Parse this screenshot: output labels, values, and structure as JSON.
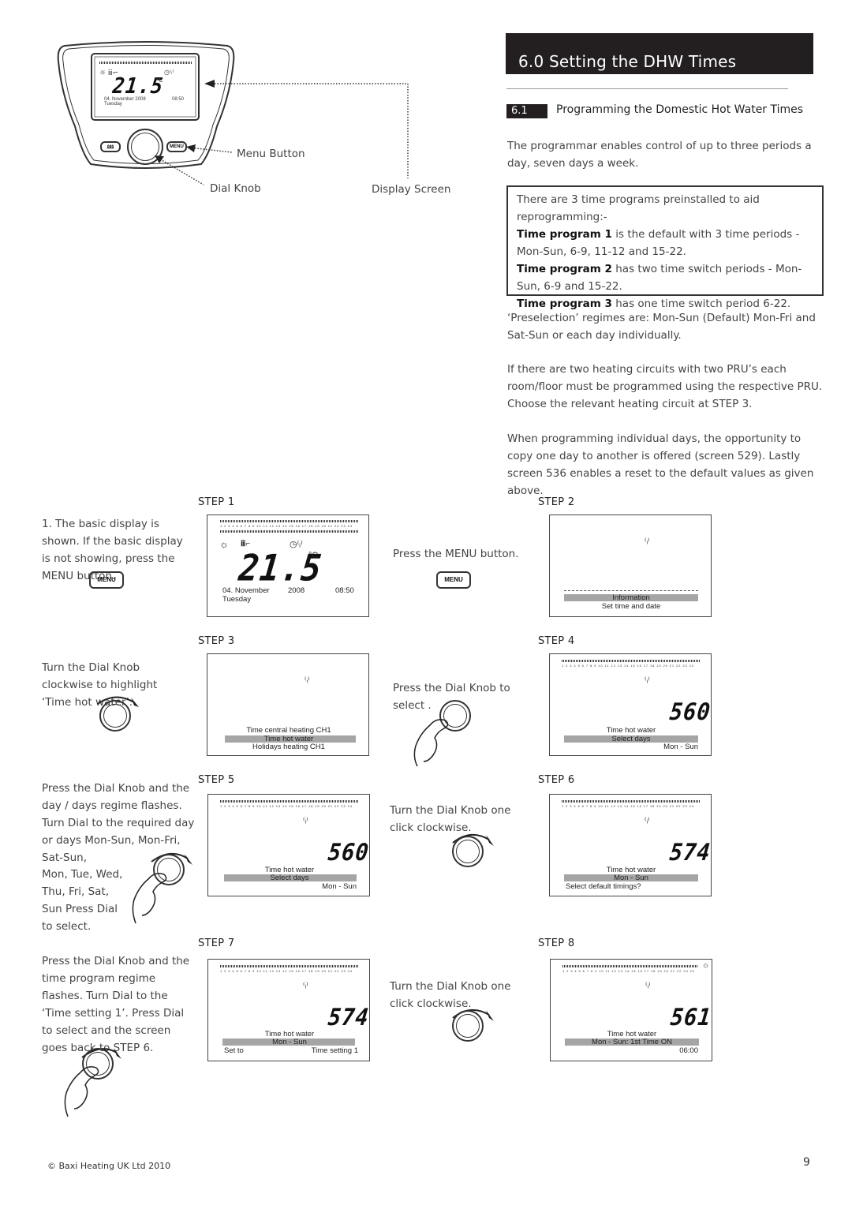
{
  "header": {
    "title": "6.0   Setting the DHW Times",
    "section_number": "6.1",
    "section_title": "Programming the Domestic Hot Water Times"
  },
  "intro": "The programmar enables control of up to three periods a day, seven days a week.",
  "programs_box": {
    "intro": "There are 3 time programs preinstalled to aid reprogramming:-",
    "items": [
      {
        "label": "Time program 1",
        "text": " is the default with 3 time periods - Mon-Sun, 6-9, 11-12 and 15-22."
      },
      {
        "label": "Time program 2",
        "text": " has two time switch periods - Mon-Sun, 6-9 and 15-22."
      },
      {
        "label": "Time program 3",
        "text": " has one time switch period 6-22."
      }
    ]
  },
  "paragraphs": [
    "‘Preselection’ regimes are: Mon-Sun (Default) Mon-Fri and Sat-Sun or each day individually.",
    "If there are two heating circuits with two PRU’s each room/floor must be programmed using the respective PRU. Choose the relevant heating circuit at STEP 3.",
    "When programming individual days, the opportunity to copy one day to another is offered (screen 529). Lastly screen 536 enables a reset to the default values as given above."
  ],
  "device_diagram": {
    "labels": {
      "menu_button": "Menu Button",
      "dial_knob": "Dial Knob",
      "display_screen": "Display Screen"
    },
    "screen": {
      "temp": "21.5",
      "unit": "°C",
      "date": "04.  November   2008",
      "time": "08:50",
      "day": "Tuesday"
    },
    "menu_label": "MENU"
  },
  "steps": [
    {
      "label": "STEP 1",
      "instruction": "1. The basic display is shown. If the basic display is not showing, press the MENU button.",
      "screen": {
        "temp": "21.5",
        "unit": "°C",
        "date": "04.  November",
        "year": "2008",
        "time": "08:50",
        "day": "Tuesday"
      }
    },
    {
      "label": "STEP 2",
      "instruction": "Press the MENU button.",
      "screen": {
        "highlight": "Information",
        "line2": "Set time and date"
      }
    },
    {
      "label": "STEP 3",
      "instruction": "Turn the Dial Knob clockwise to highlight ‘Time hot water’.",
      "screen": {
        "line1": "Time  central heating  CH1",
        "highlight": "Time hot water",
        "line3": "Holidays  heating  CH1"
      }
    },
    {
      "label": "STEP 4",
      "instruction": "Press the Dial Knob to select .",
      "screen": {
        "code": "560",
        "line1": "Time  hot water",
        "highlight": "Select days",
        "line3": "Mon - Sun"
      }
    },
    {
      "label": "STEP 5",
      "instruction": "Press the Dial Knob and the day / days regime flashes. Turn Dial to the required day or days Mon-Sun, Mon-Fri, Sat-Sun,",
      "instruction2": "Mon, Tue, Wed, Thu, Fri, Sat, Sun Press Dial to select.",
      "screen": {
        "code": "560",
        "line1": "Time  hot water",
        "highlight": "Select days",
        "line3": "Mon - Sun"
      }
    },
    {
      "label": "STEP 6",
      "instruction": "Turn the Dial Knob one click clockwise.",
      "screen": {
        "code": "574",
        "line1": "Time  hot water",
        "highlight": "Mon - Sun",
        "line3": "Select default timings?"
      }
    },
    {
      "label": "STEP 7",
      "instruction": "Press the Dial Knob and the time program regime flashes. Turn Dial to the ‘Time setting 1’. Press Dial to select and the screen goes back to STEP 6.",
      "screen": {
        "code": "574",
        "line1": "Time  hot water",
        "highlight": "Mon - Sun",
        "line3_left": "Set to",
        "line3_right": "Time setting 1"
      }
    },
    {
      "label": "STEP 8",
      "instruction": "Turn the Dial Knob one click clockwise.",
      "screen": {
        "code": "561",
        "line1": "Time  hot water",
        "highlight": "Mon - Sun: 1st Time ON",
        "line3": "06:00"
      }
    }
  ],
  "timeline_hours": "1 2 3 4 5 6 7 8 9 10 11 12 13 14 15 16 17 18 19 20 21 22 23 24",
  "menu_label": "MENU",
  "footer": {
    "copyright": "© Baxi Heating UK Ltd 2010",
    "page_number": "9"
  }
}
